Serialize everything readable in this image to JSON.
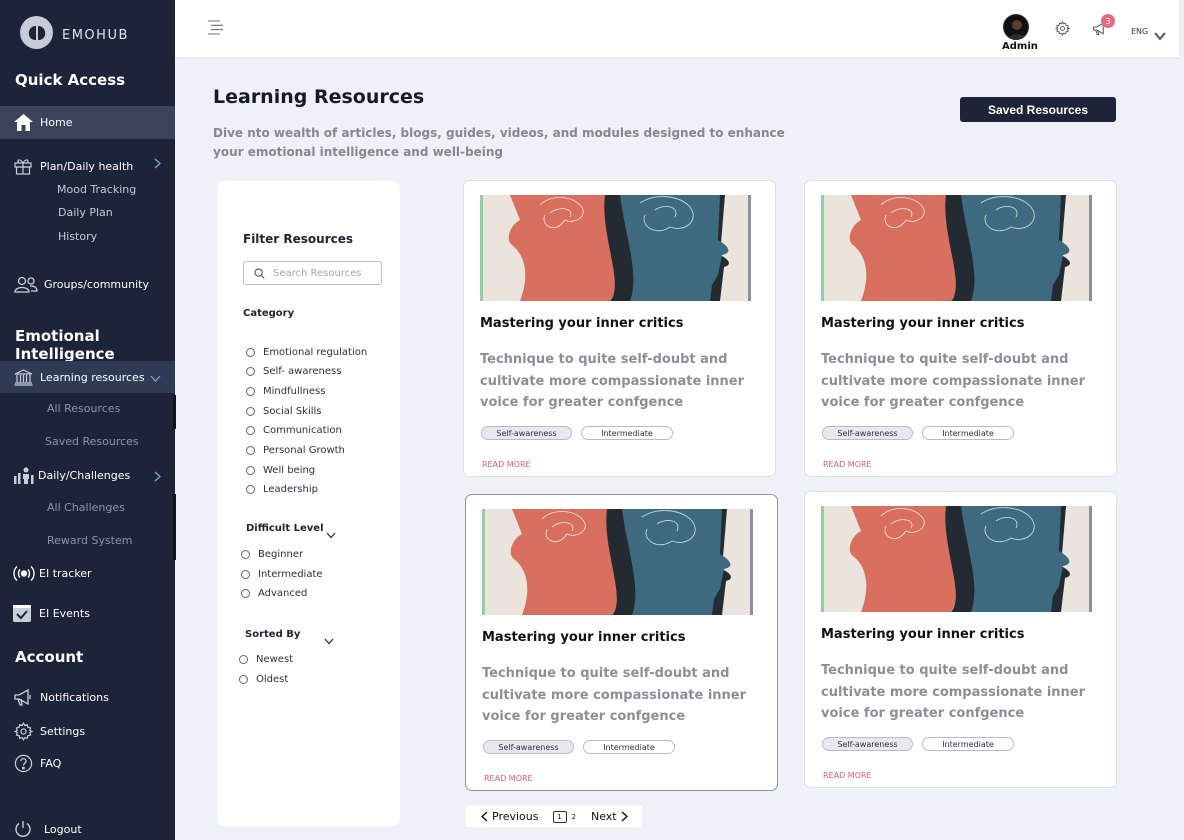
{
  "brand": {
    "name": "EMOHUB"
  },
  "sidebar": {
    "quick_access": "Quick Access",
    "home": "Home",
    "plan": "Plan/Daily health",
    "mood": "Mood Tracking",
    "daily_plan": "Daily Plan",
    "history": "History",
    "groups": "Groups/community",
    "ei_heading": "Emotional Intelligence",
    "learning": "Learning resources",
    "all_resources": "All Resources",
    "saved_resources": "Saved Resources",
    "challenges": "Daily/Challenges",
    "all_challenges": "All Challenges",
    "reward": "Reward System",
    "ei_tracker": "EI tracker",
    "ei_events": "EI Events",
    "account": "Account",
    "notifications": "Notifications",
    "settings": "Settings",
    "faq": "FAQ",
    "logout": "Logout"
  },
  "topbar": {
    "user": "Admin",
    "badge": "3",
    "lang": "ENG"
  },
  "main": {
    "title": "Learning Resources",
    "description": "Dive nto wealth of  articles, blogs, guides, videos, and modules designed to enhance your emotional intelligence and well-being",
    "saved_button": "Saved Resources"
  },
  "filter": {
    "title": "Filter Resources",
    "search_placeholder": "Search Resources",
    "category_label": "Category",
    "categories": [
      "Emotional regulation",
      "Self- awareness",
      "Mindfullness",
      "Social Skills",
      "Communication",
      "Personal Growth",
      "Well being",
      "Leadership"
    ],
    "level_label": "Difficult Level",
    "levels": [
      "Beginner",
      "Intermediate",
      "Advanced"
    ],
    "sort_label": "Sorted By",
    "sorts": [
      "Newest",
      "Oldest"
    ]
  },
  "cards": [
    {
      "title": "Mastering your inner critics",
      "desc": "Technique to quite self-doubt and cultivate more compassionate inner voice for greater confgence",
      "tag1": "Self-awareness",
      "tag2": "Intermediate",
      "read_more": "READ MORE"
    },
    {
      "title": "Mastering your inner critics",
      "desc": "Technique to quite self-doubt and cultivate more compassionate inner voice for greater confgence",
      "tag1": "Self-awareness",
      "tag2": "Intermediate",
      "read_more": "READ MORE"
    },
    {
      "title": "Mastering your inner critics",
      "desc": "Technique to quite self-doubt and cultivate more compassionate inner voice for greater confgence",
      "tag1": "Self-awareness",
      "tag2": "Intermediate",
      "read_more": "READ MORE"
    },
    {
      "title": "Mastering your inner critics",
      "desc": "Technique to quite self-doubt and cultivate more compassionate inner voice for greater confgence",
      "tag1": "Self-awareness",
      "tag2": "Intermediate",
      "read_more": "READ MORE"
    }
  ],
  "pagination": {
    "previous": "Previous",
    "page1": "1",
    "page2": "2",
    "next": "Next"
  },
  "colors": {
    "sidebar": "#1d2439",
    "accent_active": "#2f3a55",
    "read_more": "#e05b78",
    "face_orange": "#d96f5e",
    "face_blue": "#3e6a80"
  }
}
